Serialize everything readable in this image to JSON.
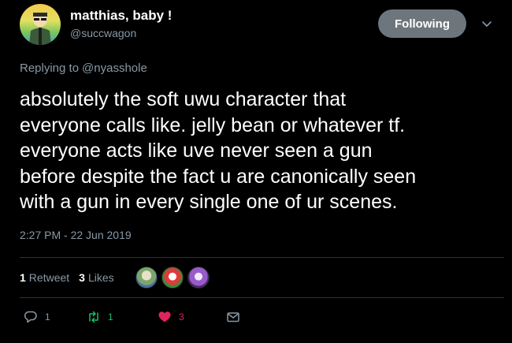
{
  "header": {
    "display_name": "matthias, baby !",
    "handle": "@succwagon",
    "follow_button_label": "Following",
    "caret_icon": "chevron-down-icon"
  },
  "reply": {
    "prefix": "Replying to",
    "mention": "@nyasshole"
  },
  "tweet": {
    "lines": [
      "absolutely the soft uwu character that",
      "everyone calls like. jelly bean or whatever tf.",
      "everyone acts like uve never seen a gun",
      "before despite the fact u are canonically seen",
      "with a gun in every single one of ur scenes."
    ],
    "timestamp": "2:27 PM - 22 Jun 2019"
  },
  "stats": {
    "retweet_count": "1",
    "retweet_label": "Retweet",
    "like_count": "3",
    "like_label": "Likes"
  },
  "actions": {
    "reply_count": "1",
    "retweet_count": "1",
    "like_count": "3"
  },
  "colors": {
    "background": "#000000",
    "secondary_text": "#8899a6",
    "follow_button": "#6e767d",
    "retweet_green": "#17bf63",
    "like_red": "#e0245e",
    "divider": "#2f3336"
  }
}
